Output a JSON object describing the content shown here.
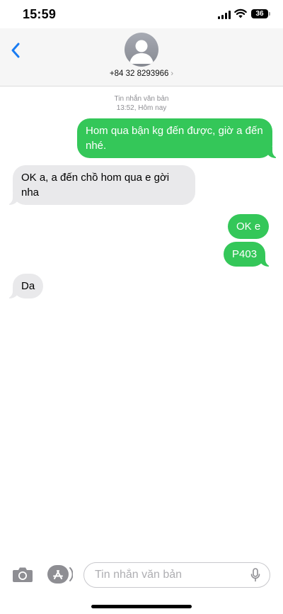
{
  "status_bar": {
    "time": "15:59",
    "battery_level": "36"
  },
  "header": {
    "back_icon": "chevron-left-icon",
    "contact_number": "+84 32 8293966",
    "contact_chevron": "›"
  },
  "thread": {
    "timestamp_line1": "Tin nhắn văn bản",
    "timestamp_line2": "13:52, Hôm nay",
    "messages": [
      {
        "direction": "outgoing",
        "text": "Hom qua bận kg đến được, giờ a đến nhé."
      },
      {
        "direction": "incoming",
        "text": "OK a, a đến chồ hom qua e gời nha"
      },
      {
        "direction": "outgoing",
        "text": "OK e"
      },
      {
        "direction": "outgoing",
        "text": "P403"
      },
      {
        "direction": "incoming",
        "text": "Da"
      }
    ]
  },
  "input_bar": {
    "placeholder": "Tin nhắn văn bản",
    "value": ""
  },
  "colors": {
    "outgoing_bubble": "#34c759",
    "incoming_bubble": "#e9e9eb",
    "accent": "#1a7cf2"
  }
}
